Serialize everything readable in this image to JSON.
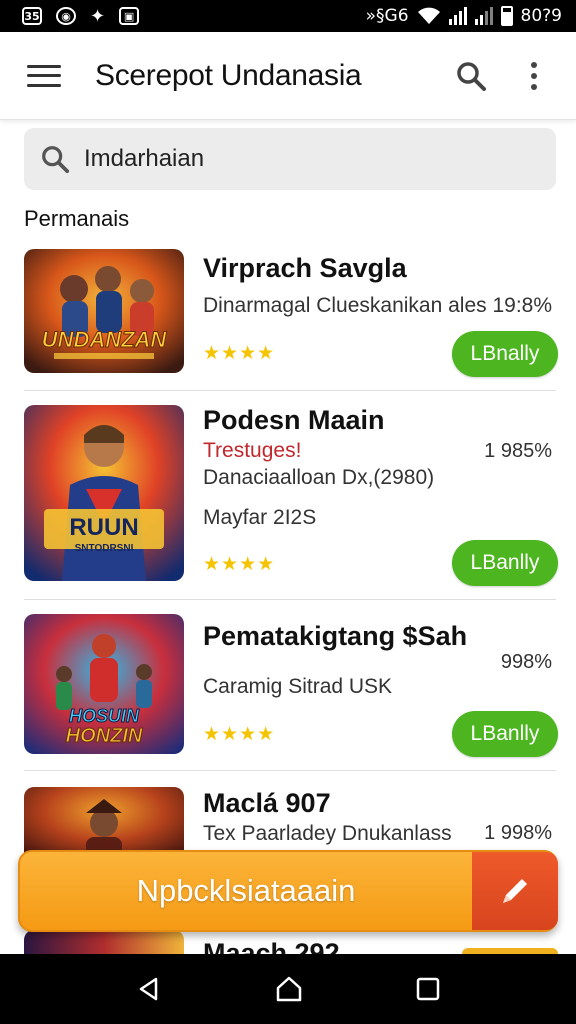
{
  "status_bar": {
    "right_text": "»§G6",
    "time": "80?9"
  },
  "app_bar": {
    "title": "Scerepot Undanasia"
  },
  "search": {
    "value": "Imdarhaian"
  },
  "section": {
    "heading": "Permanais"
  },
  "rows": [
    {
      "title": "Virprach Savgla",
      "line1": "Dinarmagal Clueskanikan ales 19:8%",
      "stars": "★★★★",
      "button": "LBnally",
      "thumb_text": "UNDANZAN",
      "thumb_colors": [
        "#3b1a12",
        "#d8571a",
        "#f3b23a"
      ]
    },
    {
      "title": "Podesn Maain",
      "tag": "Trestuges!",
      "pct": "1 985%",
      "line1": "Danaciaalloan Dx,(2980)",
      "line2": "Mayfar 2I2S",
      "stars": "★★★★",
      "button": "LBanlly",
      "thumb_text1": "RUUN",
      "thumb_text2": "SNTODRSNI",
      "thumb_colors": [
        "#122a6e",
        "#e04226",
        "#f5c233"
      ]
    },
    {
      "title": "Pematakigtang $Sah",
      "pct": "998%",
      "line1": "Caramig Sitrad USK",
      "stars": "★★★★",
      "button": "LBanlly",
      "thumb_text1": "HOSUIN",
      "thumb_text2": "HONZIN",
      "thumb_colors": [
        "#1a2c7a",
        "#c92f3c",
        "#33b6e6"
      ]
    },
    {
      "title": "Maclá 907",
      "line1": "Tex Paarladey Dnukanlass",
      "pct": "1 998%",
      "thumb_colors": [
        "#3a120e",
        "#b6421c",
        "#f0a02c"
      ]
    },
    {
      "title": "Maach 292",
      "thumb_colors": [
        "#2a1640",
        "#b02e2e",
        "#f0b43a"
      ]
    }
  ],
  "fab": {
    "label": "Npbcklsiataaain"
  },
  "colors": {
    "accent_green": "#4cb51f",
    "fab_orange": "#f59a14",
    "fab_edit_red": "#d8441e",
    "tag_red": "#c0282c",
    "star_yellow": "#f5c400"
  },
  "icons": [
    "menu-icon",
    "search-icon",
    "more-vert-icon",
    "edit-icon",
    "back-icon",
    "home-icon",
    "recents-icon"
  ]
}
